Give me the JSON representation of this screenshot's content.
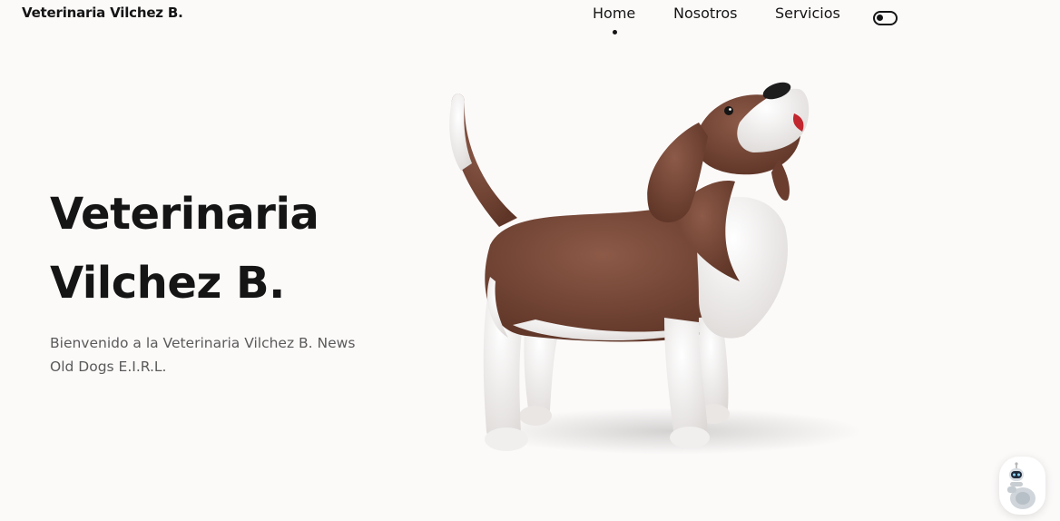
{
  "header": {
    "brand": "Veterinaria Vilchez B.",
    "nav": {
      "home": "Home",
      "nosotros": "Nosotros",
      "servicios": "Servicios"
    },
    "active_item": "Home",
    "theme_toggle_icon": "toggle-icon"
  },
  "hero": {
    "title_line1": "Veterinaria",
    "title_line2": "Vilchez B.",
    "description_line1": "Bienvenido a la Veterinaria Vilchez B. News",
    "description_line2": "Old Dogs E.I.R.L.",
    "illustration": "beagle-dog-3d-illustration"
  },
  "chat_widget": {
    "icon": "robot-icon"
  },
  "colors": {
    "background": "#fcfaf9",
    "text": "#151515",
    "muted_text": "#5a5a5a",
    "dog_brown": "#7a4a3a",
    "dog_white": "#f4f2f1"
  }
}
